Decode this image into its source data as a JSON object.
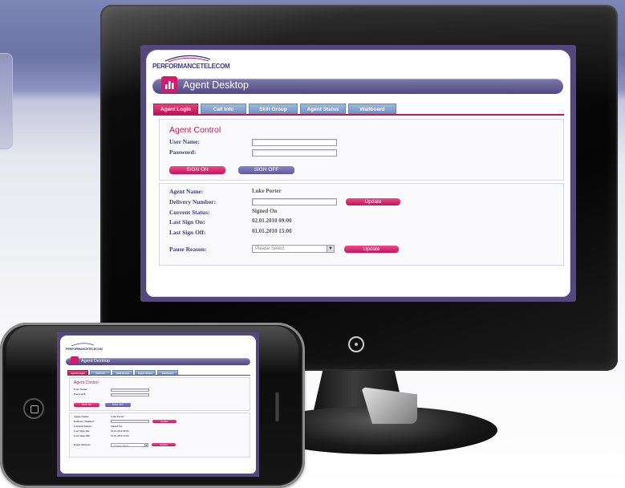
{
  "app": {
    "logo_text": "PERFORMANCETELECOM",
    "logo_tagline": "",
    "title": "Agent Desktop",
    "tabs": [
      {
        "label": "Agent Login",
        "active": true
      },
      {
        "label": "Call Info",
        "active": false
      },
      {
        "label": "Skill Group",
        "active": false
      },
      {
        "label": "Agent Status",
        "active": false
      },
      {
        "label": "Wallboard",
        "active": false
      }
    ],
    "agent_control": {
      "title": "Agent Control",
      "username_label": "User Name:",
      "username_value": "",
      "password_label": "Password:",
      "password_value": "",
      "sign_on_label": "SIGN ON",
      "sign_off_label": "SIGN OFF"
    },
    "status": {
      "agent_name_label": "Agent Name:",
      "agent_name_value": "Luke Porter",
      "delivery_number_label": "Delivery Number:",
      "delivery_number_value": "",
      "update_label": "Update",
      "current_status_label": "Current Status:",
      "current_status_value": "Signed On",
      "last_sign_on_label": "Last Sign On:",
      "last_sign_on_value": "02.01.2010 09:00",
      "last_sign_off_label": "Last Sign Off:",
      "last_sign_off_value": "01.01.2010 15:00",
      "pause_reason_label": "Pause Reason:",
      "pause_reason_selected": "Please Select",
      "pause_update_label": "Update"
    }
  },
  "colors": {
    "accent_pink": "#c9195e",
    "header_purple": "#4f4884",
    "tab_blue": "#7193c4",
    "frame_purple": "#53477d"
  },
  "icons": {
    "header": "agent-desktop-icon",
    "select_arrow": "chevron-down-icon",
    "power": "power-icon",
    "home": "home-button-icon"
  }
}
